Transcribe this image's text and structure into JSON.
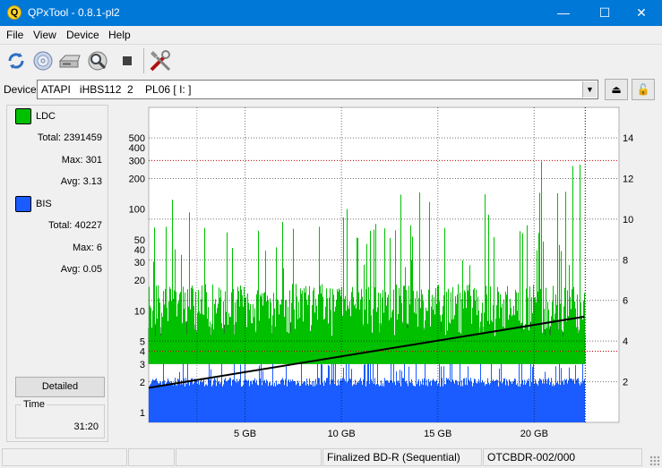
{
  "window": {
    "title": "QPxTool - 0.8.1-pl2",
    "app_icon_glyph": "Q",
    "minimize_glyph": "—",
    "maximize_glyph": "☐",
    "close_glyph": "✕"
  },
  "menu": [
    "File",
    "View",
    "Device",
    "Help"
  ],
  "toolbar": {
    "buttons": [
      "refresh-icon",
      "disc-info-icon",
      "drive-icon",
      "scan-icon",
      "stop-icon",
      "settings-tools-icon"
    ]
  },
  "device": {
    "label": "Device:",
    "value": "ATAPI   iHBS112  2    PL06 [ I: ]",
    "dropdown_glyph": "▼",
    "eject_glyph": "⏏",
    "lock_glyph": "🔓"
  },
  "stats": {
    "ldc": {
      "name": "LDC",
      "color": "#00c000",
      "total_label": "Total:",
      "total": "2391459",
      "max_label": "Max:",
      "max": "301",
      "avg_label": "Avg:",
      "avg": "3.13"
    },
    "bis": {
      "name": "BIS",
      "color": "#1a5cff",
      "total_label": "Total:",
      "total": "40227",
      "max_label": "Max:",
      "max": "6",
      "avg_label": "Avg:",
      "avg": "0.05"
    },
    "detailed_label": "Detailed",
    "time_label": "Time",
    "time_value": "31:20"
  },
  "chart_data": {
    "type": "bar",
    "x_unit": "GB",
    "xlim": [
      0,
      24.4
    ],
    "x_ticks": [
      5,
      10,
      15,
      20
    ],
    "x_tick_labels": [
      "5 GB",
      "10 GB",
      "15 GB",
      "20 GB"
    ],
    "disc_end_gb": 22.6,
    "y_left_scale": "log",
    "y_left_lim": [
      0.8,
      1000
    ],
    "y_left_ticks": [
      1,
      2,
      3,
      4,
      5,
      10,
      20,
      30,
      40,
      50,
      100,
      200,
      300,
      400,
      500
    ],
    "y_right_lim": [
      0,
      15.5
    ],
    "y_right_ticks": [
      2,
      4,
      6,
      8,
      10,
      12,
      14
    ],
    "threshold_line_left": 300,
    "threshold_line_right_gb": 3.5,
    "grid": true,
    "series": [
      {
        "name": "LDC",
        "color": "#00c000",
        "axis": "left",
        "typical": 8,
        "peak": 301
      },
      {
        "name": "BIS",
        "color": "#1a5cff",
        "axis": "left",
        "typical": 2,
        "peak": 6
      },
      {
        "color": "#000000",
        "axis": "right",
        "x": [
          0,
          22.6
        ],
        "y": [
          1.7,
          5.2
        ]
      }
    ]
  },
  "statusbar": {
    "cells": [
      "",
      "",
      "",
      "Finalized BD-R (Sequential)",
      "OTCBDR-002/000"
    ]
  }
}
